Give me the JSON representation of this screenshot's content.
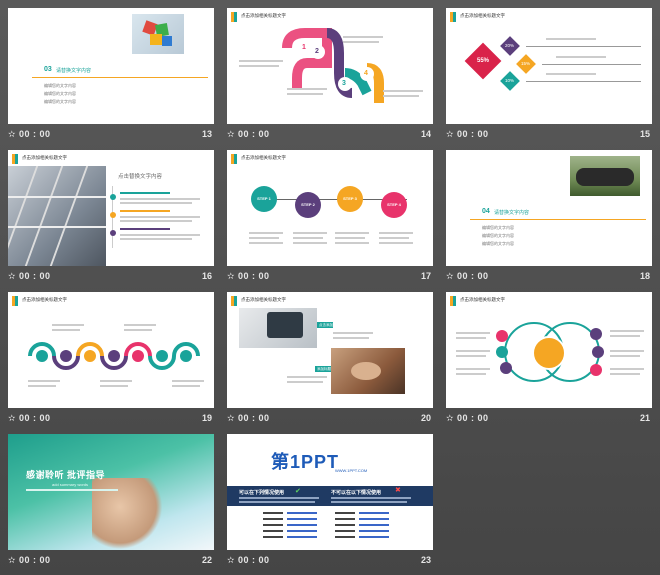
{
  "slides": [
    {
      "number": "13",
      "time": "00 : 00",
      "section": "03",
      "title": "请替换文字内容",
      "items": [
        "编辑您的文字内容",
        "编辑您的文字内容",
        "编辑您的文字内容"
      ]
    },
    {
      "number": "14",
      "time": "00 : 00",
      "header": "点击添加相关标题文字",
      "steps": [
        "1",
        "2",
        "3",
        "4"
      ]
    },
    {
      "number": "15",
      "time": "00 : 00",
      "header": "点击添加相关标题文字",
      "pcts": [
        "55%",
        "20%",
        "15%",
        "10%"
      ]
    },
    {
      "number": "16",
      "time": "00 : 00",
      "header": "点击添加相关标题文字",
      "subtitle": "点击替换文字内容"
    },
    {
      "number": "17",
      "time": "00 : 00",
      "header": "点击添加相关标题文字",
      "steps": [
        "STEP 1",
        "STEP 2",
        "STEP 3",
        "STEP 4"
      ]
    },
    {
      "number": "18",
      "time": "00 : 00",
      "section": "04",
      "title": "请替换文字内容",
      "items": [
        "编辑您的文字内容",
        "编辑您的文字内容",
        "编辑您的文字内容"
      ]
    },
    {
      "number": "19",
      "time": "00 : 00",
      "header": "点击添加相关标题文字"
    },
    {
      "number": "20",
      "time": "00 : 00",
      "header": "点击添加相关标题文字",
      "labels": [
        "点击添加标题",
        "添加标题"
      ]
    },
    {
      "number": "21",
      "time": "00 : 00",
      "header": "点击添加相关标题文字"
    },
    {
      "number": "22",
      "time": "00 : 00",
      "title": "感谢聆听 批评指导",
      "subtitle": "add summary words"
    },
    {
      "number": "23",
      "time": "00 : 00",
      "logo": "第1PPT",
      "url": "WWW.1PPT.COM",
      "left_title": "可以在下列情况使用",
      "right_title": "不可以在以下情况使用"
    }
  ],
  "colors": {
    "orange": "#f5a623",
    "teal": "#1aa39a",
    "purple": "#5b3f7c",
    "pink": "#e8336b",
    "red": "#d9234a"
  }
}
